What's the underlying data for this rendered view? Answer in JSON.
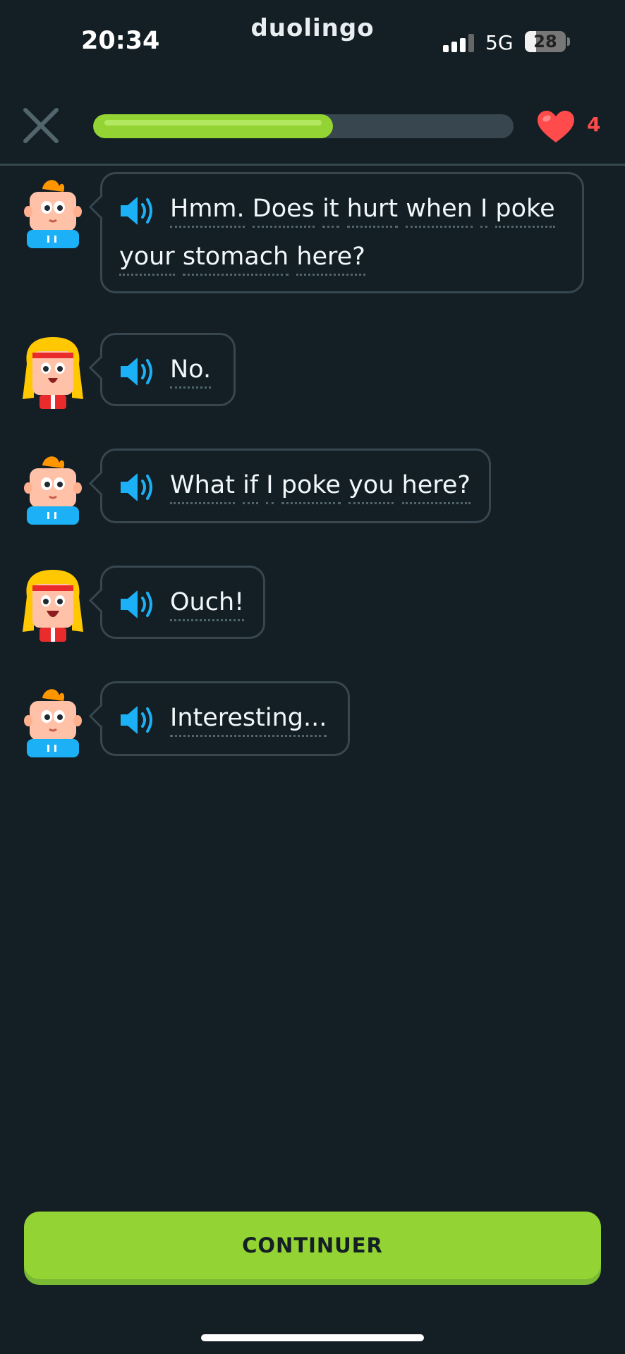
{
  "status_bar": {
    "time": "20:34",
    "brand": "duolingo",
    "network": "5G",
    "battery": "28",
    "battery_level_percent": 28
  },
  "header": {
    "close_icon": "close-icon",
    "progress_percent": 57,
    "hearts": "4",
    "heart_color": "#ff4b4b",
    "progress_color": "#93d333"
  },
  "chat": [
    {
      "speaker": "boy",
      "line1": "Hmm. Does it hurt when I poke",
      "line2": "your stomach here?"
    },
    {
      "speaker": "girl",
      "line1": "No."
    },
    {
      "speaker": "boy",
      "line1": "What if I poke you here?"
    },
    {
      "speaker": "girl",
      "line1": "Ouch!"
    },
    {
      "speaker": "boy",
      "line1": "Interesting..."
    }
  ],
  "footer": {
    "continue_label": "CONTINUER"
  }
}
